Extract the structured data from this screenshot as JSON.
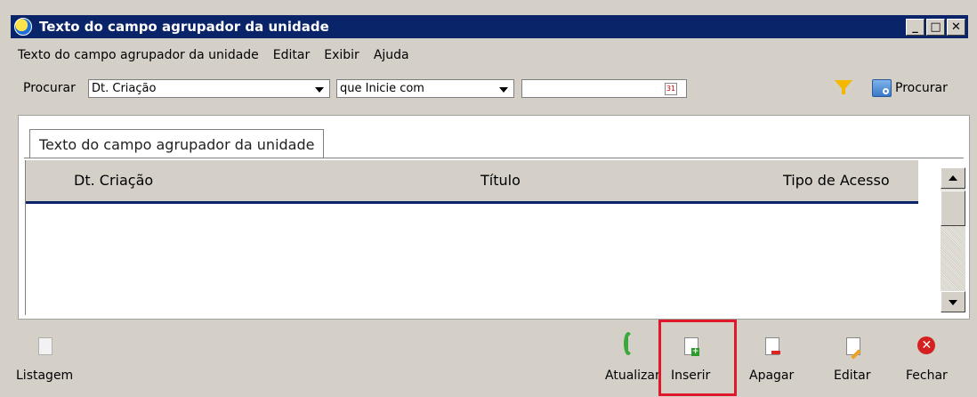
{
  "window": {
    "title": "Texto do campo agrupador da unidade"
  },
  "menu": {
    "items": [
      "Texto do campo agrupador da unidade",
      "Editar",
      "Exibir",
      "Ajuda"
    ]
  },
  "search": {
    "label": "Procurar",
    "field_value": "Dt. Criação",
    "operator_value": "que Inicie com",
    "value_text": "",
    "search_button_label": "Procurar"
  },
  "tab": {
    "label": "Texto do campo agrupador da unidade"
  },
  "grid": {
    "columns": [
      "Dt. Criação",
      "Título",
      "Tipo de Acesso"
    ],
    "rows": []
  },
  "toolbar": {
    "listagem": "Listagem",
    "atualizar": "Atualizar",
    "inserir": "Inserir",
    "apagar": "Apagar",
    "editar": "Editar",
    "fechar": "Fechar"
  },
  "highlight_color": "#e0192a"
}
